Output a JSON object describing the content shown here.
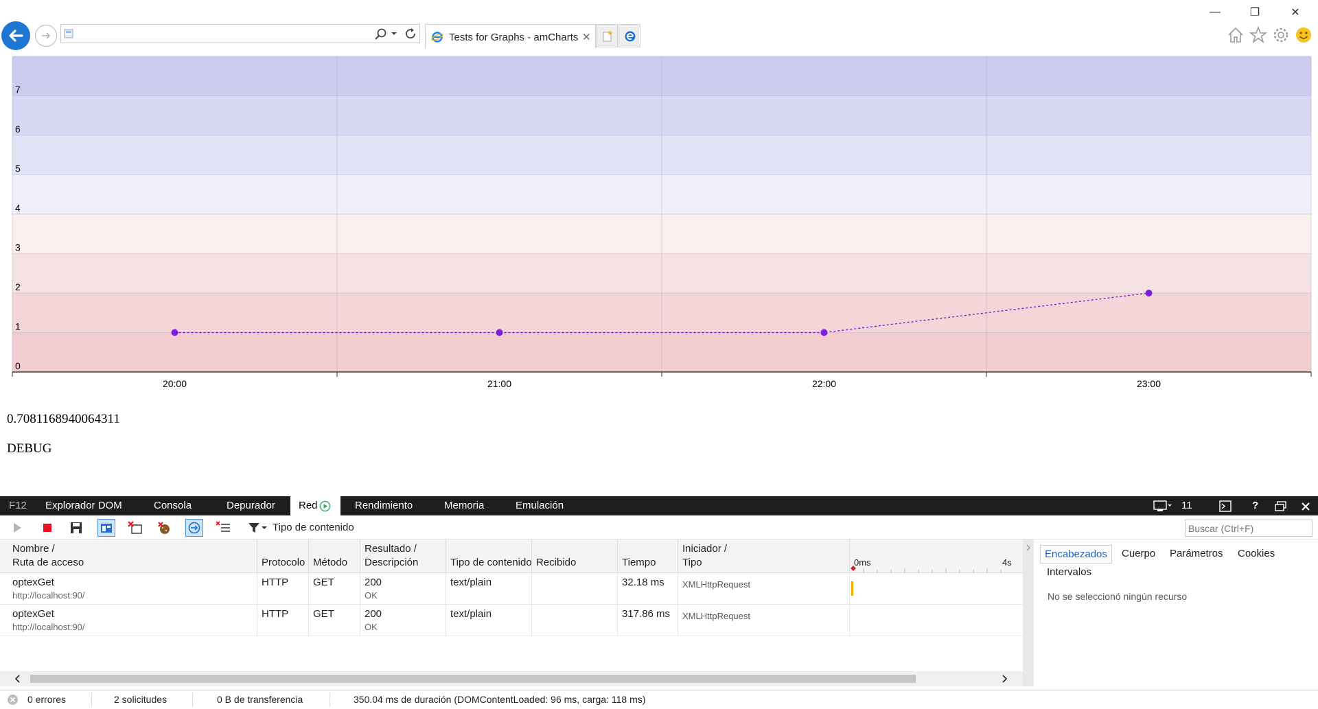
{
  "browser": {
    "window_controls": {
      "minimize": "—",
      "restore": "❐",
      "close": "✕"
    },
    "address_value": "",
    "tab_title": "Tests for Graphs - amCharts",
    "tab_close": "✕"
  },
  "page": {
    "random_value": "0.7081168940064311",
    "debug_label": "DEBUG"
  },
  "chart_data": {
    "type": "line",
    "x": [
      "20:00",
      "21:00",
      "22:00",
      "23:00"
    ],
    "series": [
      {
        "values": [
          1,
          1,
          1,
          2
        ],
        "color": "#7b1fd8",
        "style": "dashed"
      }
    ],
    "ylim": [
      0,
      8
    ],
    "yticks": [
      "0",
      "1",
      "2",
      "3",
      "4",
      "5",
      "6",
      "7"
    ],
    "xticks": [
      "20:00",
      "21:00",
      "22:00",
      "23:00"
    ],
    "grid": true,
    "bands": [
      {
        "from": 0,
        "to": 1,
        "color": "#f2cccf"
      },
      {
        "from": 1,
        "to": 2,
        "color": "#f4d6d8"
      },
      {
        "from": 2,
        "to": 3,
        "color": "#f7e2e3"
      },
      {
        "from": 3,
        "to": 4,
        "color": "#fbefee"
      },
      {
        "from": 4,
        "to": 5,
        "color": "#eeeffb"
      },
      {
        "from": 5,
        "to": 6,
        "color": "#e3e3f7"
      },
      {
        "from": 6,
        "to": 7,
        "color": "#d8d8f4"
      },
      {
        "from": 7,
        "to": 8,
        "color": "#ccccf1"
      }
    ]
  },
  "devtools": {
    "tabs": {
      "f12": "F12",
      "dom": "Explorador DOM",
      "console": "Consola",
      "debugger": "Depurador",
      "network": "Red",
      "performance": "Rendimiento",
      "memory": "Memoria",
      "emulation": "Emulación"
    },
    "doc_mode": "11",
    "help": "?",
    "toolbar": {
      "content_type_filter": "Tipo de contenido",
      "search_placeholder": "Buscar (Ctrl+F)"
    },
    "columns": {
      "name_line1": "Nombre /",
      "name_line2": "Ruta de acceso",
      "protocol": "Protocolo",
      "method": "Método",
      "result_line1": "Resultado /",
      "result_line2": "Descripción",
      "content_type": "Tipo de contenido",
      "received": "Recibido",
      "time": "Tiempo",
      "initiator_line1": "Iniciador /",
      "initiator_line2": "Tipo",
      "timeline_start": "0ms",
      "timeline_end": "4s"
    },
    "rows": [
      {
        "name": "optexGet",
        "path": "http://localhost:90/",
        "protocol": "HTTP",
        "method": "GET",
        "status": "200",
        "status_text": "OK",
        "type": "text/plain",
        "received": "",
        "time": "32.18 ms",
        "initiator": "XMLHttpRequest"
      },
      {
        "name": "optexGet",
        "path": "http://localhost:90/",
        "protocol": "HTTP",
        "method": "GET",
        "status": "200",
        "status_text": "OK",
        "type": "text/plain",
        "received": "",
        "time": "317.86 ms",
        "initiator": "XMLHttpRequest"
      }
    ],
    "details": {
      "tabs": {
        "headers": "Encabezados",
        "body": "Cuerpo",
        "params": "Parámetros",
        "cookies": "Cookies",
        "timings": "Intervalos"
      },
      "empty_message": "No se seleccionó ningún recurso"
    },
    "status": {
      "errors": "0 errores",
      "requests": "2 solicitudes",
      "transferred": "0 B de transferencia",
      "duration": "350.04 ms de duración (DOMContentLoaded: 96 ms, carga: 118 ms)"
    }
  }
}
